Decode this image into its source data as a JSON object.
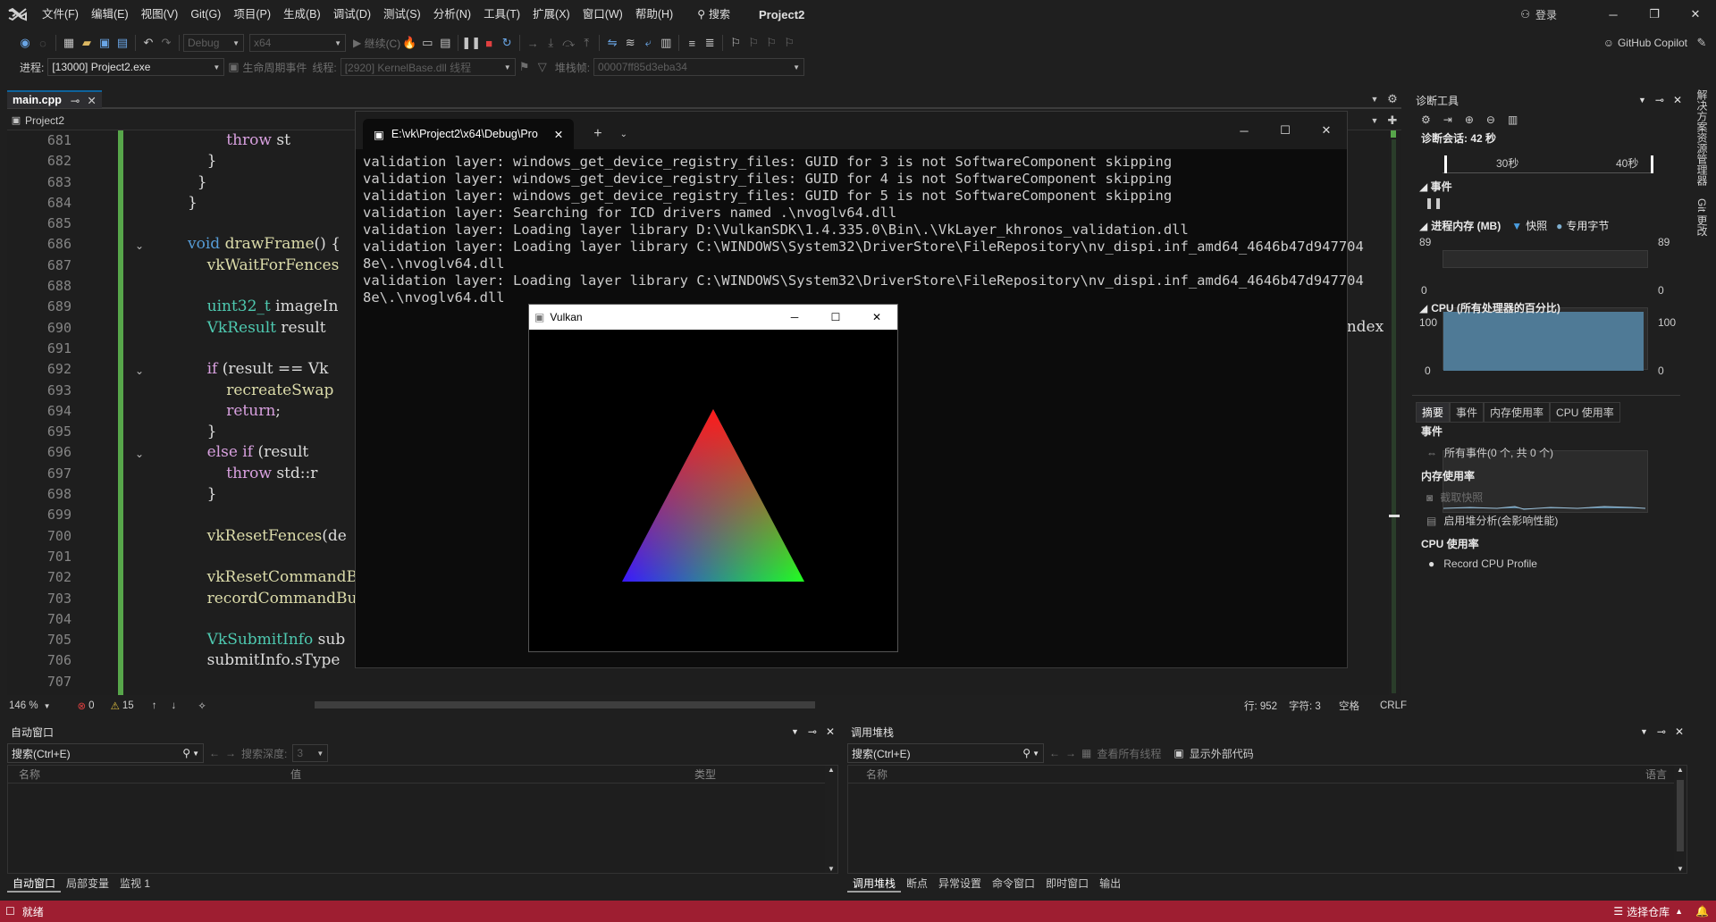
{
  "menu": {
    "items": [
      "文件(F)",
      "编辑(E)",
      "视图(V)",
      "Git(G)",
      "项目(P)",
      "生成(B)",
      "调试(D)",
      "测试(S)",
      "分析(N)",
      "工具(T)",
      "扩展(X)",
      "窗口(W)",
      "帮助(H)"
    ],
    "search": "搜索",
    "project": "Project2",
    "signin": "登录"
  },
  "toolbar": {
    "config": "Debug",
    "platform": "x64",
    "continue": "继续(C)",
    "copilot": "GitHub Copilot"
  },
  "debugbar": {
    "process_label": "进程:",
    "process": "[13000] Project2.exe",
    "lifecycle": "生命周期事件",
    "thread_label": "线程:",
    "thread": "[2920] KernelBase.dll 线程",
    "stack_label": "堆栈帧:",
    "stack": "00007ff85d3eba34"
  },
  "editor": {
    "tab": "main.cpp",
    "project": "Project2",
    "zoom": "146 %",
    "errors": "0",
    "warnings": "15",
    "line": "行: 952",
    "char": "字符: 3",
    "space": "空格",
    "eol": "CRLF",
    "overflow_text": "Index",
    "lines": [
      {
        "n": "681",
        "html": "        <span class='ctl'>throw</span> st"
      },
      {
        "n": "682",
        "html": "    }"
      },
      {
        "n": "683",
        "html": "  }"
      },
      {
        "n": "684",
        "html": "}"
      },
      {
        "n": "685",
        "html": ""
      },
      {
        "n": "686",
        "html": "<span class='kw'>void</span> <span class='fn'>drawFrame</span>() {"
      },
      {
        "n": "687",
        "html": "    <span class='fn'>vkWaitForFences</span>"
      },
      {
        "n": "688",
        "html": ""
      },
      {
        "n": "689",
        "html": "    <span class='ty'>uint32_t</span> imageIn"
      },
      {
        "n": "690",
        "html": "    <span class='ty'>VkResult</span> result"
      },
      {
        "n": "691",
        "html": ""
      },
      {
        "n": "692",
        "html": "    <span class='ctl'>if</span> (result == Vk"
      },
      {
        "n": "693",
        "html": "        <span class='fn'>recreateSwap</span>"
      },
      {
        "n": "694",
        "html": "        <span class='ctl'>return</span>;"
      },
      {
        "n": "695",
        "html": "    }"
      },
      {
        "n": "696",
        "html": "    <span class='ctl'>else if</span> (result"
      },
      {
        "n": "697",
        "html": "        <span class='ctl'>throw</span> std::r"
      },
      {
        "n": "698",
        "html": "    }"
      },
      {
        "n": "699",
        "html": ""
      },
      {
        "n": "700",
        "html": "    <span class='fn'>vkResetFences</span>(de"
      },
      {
        "n": "701",
        "html": ""
      },
      {
        "n": "702",
        "html": "    <span class='fn'>vkResetCommandBu</span>"
      },
      {
        "n": "703",
        "html": "    <span class='fn'>recordCommandBuf</span>"
      },
      {
        "n": "704",
        "html": ""
      },
      {
        "n": "705",
        "html": "    <span class='ty'>VkSubmitInfo</span> sub"
      },
      {
        "n": "706",
        "html": "    submitInfo.sType"
      },
      {
        "n": "707",
        "html": ""
      }
    ]
  },
  "console": {
    "tab_title": "E:\\vk\\Project2\\x64\\Debug\\Pro",
    "text": "validation layer: windows_get_device_registry_files: GUID for 3 is not SoftwareComponent skipping\nvalidation layer: windows_get_device_registry_files: GUID for 4 is not SoftwareComponent skipping\nvalidation layer: windows_get_device_registry_files: GUID for 5 is not SoftwareComponent skipping\nvalidation layer: Searching for ICD drivers named .\\nvoglv64.dll\nvalidation layer: Loading layer library D:\\VulkanSDK\\1.4.335.0\\Bin\\.\\VkLayer_khronos_validation.dll\nvalidation layer: Loading layer library C:\\WINDOWS\\System32\\DriverStore\\FileRepository\\nv_dispi.inf_amd64_4646b47d947704\n8e\\.\\nvoglv64.dll\nvalidation layer: Loading layer library C:\\WINDOWS\\System32\\DriverStore\\FileRepository\\nv_dispi.inf_amd64_4646b47d947704\n8e\\.\\nvoglv64.dll"
  },
  "vulkan": {
    "title": "Vulkan"
  },
  "diag": {
    "title": "诊断工具",
    "session": "诊断会话: 42 秒",
    "t30": "30秒",
    "t40": "40秒",
    "events": "事件",
    "memory": "进程内存 (MB)",
    "snapshot": "快照",
    "private": "专用字节",
    "mem_max": "89",
    "mem_min": "0",
    "cpu": "CPU (所有处理器的百分比)",
    "cpu_max": "100",
    "cpu_min": "0",
    "tabs": [
      "摘要",
      "事件",
      "内存使用率",
      "CPU 使用率"
    ],
    "sec_events": "事件",
    "all_events": "所有事件(0 个, 共 0 个)",
    "sec_memory": "内存使用率",
    "take_snapshot": "截取快照",
    "heap": "启用堆分析(会影响性能)",
    "sec_cpu": "CPU 使用率",
    "record": "Record CPU Profile"
  },
  "side_strip": [
    "解决方案资源管理器",
    "Git 更改"
  ],
  "autos": {
    "title": "自动窗口",
    "search": "搜索(Ctrl+E)",
    "depth_label": "搜索深度:",
    "depth": "3",
    "cols": [
      "名称",
      "值",
      "类型"
    ],
    "tabs": [
      "自动窗口",
      "局部变量",
      "监视 1"
    ]
  },
  "callstack": {
    "title": "调用堆栈",
    "search": "搜索(Ctrl+E)",
    "all_threads": "查看所有线程",
    "external": "显示外部代码",
    "cols": [
      "名称",
      "语言"
    ],
    "tabs": [
      "调用堆栈",
      "断点",
      "异常设置",
      "命令窗口",
      "即时窗口",
      "输出"
    ]
  },
  "status": {
    "ready": "就绪",
    "repo": "选择仓库"
  },
  "colors": {
    "accent": "#0e639c",
    "status_bar": "#9e1e31",
    "graph_fill": "#4f7a96"
  }
}
